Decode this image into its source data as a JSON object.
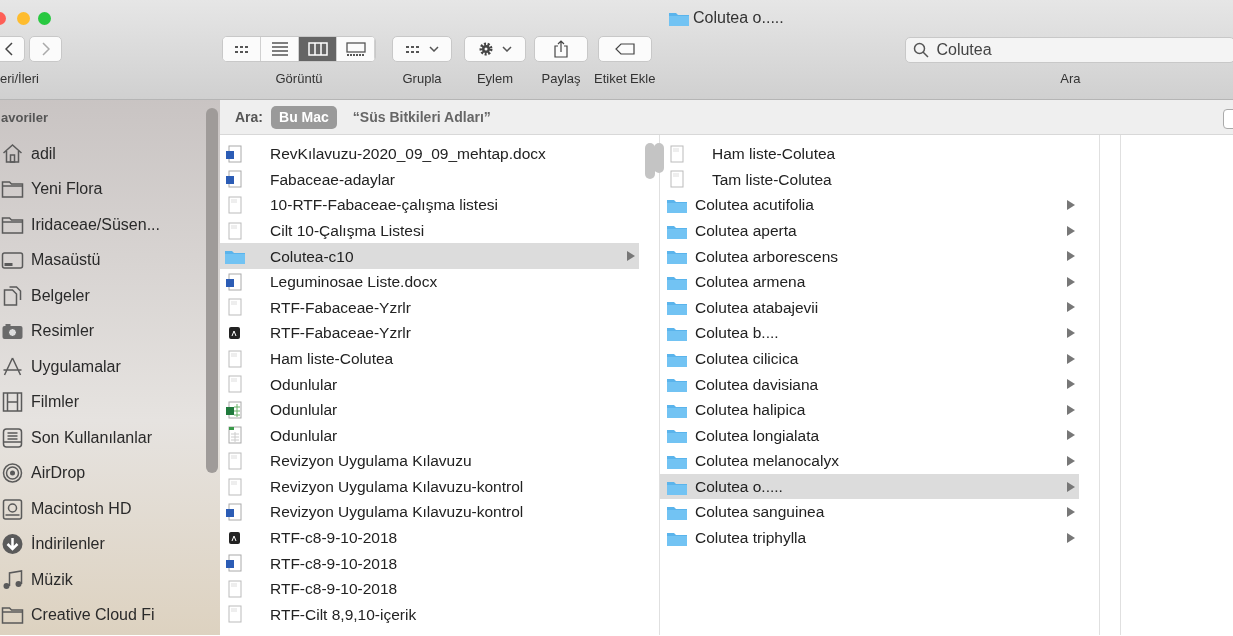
{
  "window": {
    "title": "Colutea o....."
  },
  "toolbar": {
    "nav_label": "eri/İleri",
    "view_modes": [
      {
        "kind": "icons",
        "selected": false
      },
      {
        "kind": "list",
        "selected": false
      },
      {
        "kind": "columns",
        "selected": true
      },
      {
        "kind": "gallery",
        "selected": false
      }
    ],
    "view_label": "Görüntü",
    "group_label": "Grupla",
    "action_label": "Eylem",
    "share_label": "Paylaş",
    "tag_label": "Etiket Ekle"
  },
  "search": {
    "value": "Colutea",
    "label": "Ara"
  },
  "scope_bar": {
    "label": "Ara:",
    "scopes": [
      {
        "label": "Bu Mac",
        "selected": true
      },
      {
        "label": "“Süs Bitkileri Adları”",
        "selected": false
      }
    ]
  },
  "sidebar": {
    "heading": "avoriler",
    "items": [
      {
        "kind": "home",
        "label": "adil"
      },
      {
        "kind": "folder",
        "label": "Yeni Flora"
      },
      {
        "kind": "folder",
        "label": "Iridaceae/Süsen..."
      },
      {
        "kind": "desktop",
        "label": "Masaüstü"
      },
      {
        "kind": "documents",
        "label": "Belgeler"
      },
      {
        "kind": "pictures",
        "label": "Resimler"
      },
      {
        "kind": "apps",
        "label": "Uygulamalar"
      },
      {
        "kind": "movies",
        "label": "Filmler"
      },
      {
        "kind": "recents",
        "label": "Son Kullanılanlar"
      },
      {
        "kind": "airdrop",
        "label": "AirDrop"
      },
      {
        "kind": "disk",
        "label": "Macintosh HD"
      },
      {
        "kind": "downloads",
        "label": "İndirilenler"
      },
      {
        "kind": "music",
        "label": "Müzik"
      },
      {
        "kind": "folder",
        "label": "Creative Cloud Fi"
      }
    ]
  },
  "columns": [
    {
      "rows": [
        {
          "kind": "word",
          "name": "RevKılavuzu-2020_09_09_mehtap.docx",
          "selected": false
        },
        {
          "kind": "word",
          "name": "Fabaceae-adaylar",
          "selected": false
        },
        {
          "kind": "doc",
          "name": "10-RTF-Fabaceae-çalışma listesi",
          "selected": false
        },
        {
          "kind": "doc",
          "name": "Cilt 10-Çalışma Listesi",
          "selected": false
        },
        {
          "kind": "folder",
          "name": "Colutea-c10",
          "selected": true
        },
        {
          "kind": "word",
          "name": "Leguminosae Liste.docx",
          "selected": false
        },
        {
          "kind": "doc",
          "name": "RTF-Fabaceae-Yzrlr",
          "selected": false
        },
        {
          "kind": "pdf",
          "name": "RTF-Fabaceae-Yzrlr",
          "selected": false
        },
        {
          "kind": "doc",
          "name": "Ham liste-Colutea",
          "selected": false
        },
        {
          "kind": "doc",
          "name": "Odunlular",
          "selected": false
        },
        {
          "kind": "excel",
          "name": "Odunlular",
          "selected": false
        },
        {
          "kind": "sheet",
          "name": "Odunlular",
          "selected": false
        },
        {
          "kind": "doc",
          "name": "Revizyon Uygulama Kılavuzu",
          "selected": false
        },
        {
          "kind": "doc",
          "name": "Revizyon Uygulama Kılavuzu-kontrol",
          "selected": false
        },
        {
          "kind": "word",
          "name": "Revizyon Uygulama Kılavuzu-kontrol",
          "selected": false
        },
        {
          "kind": "pdf",
          "name": "RTF-c8-9-10-2018",
          "selected": false
        },
        {
          "kind": "word",
          "name": "RTF-c8-9-10-2018",
          "selected": false
        },
        {
          "kind": "doc",
          "name": "RTF-c8-9-10-2018",
          "selected": false
        },
        {
          "kind": "doc",
          "name": "RTF-Cilt 8,9,10-içerik",
          "selected": false
        }
      ]
    },
    {
      "rows": [
        {
          "kind": "doc",
          "name": "Ham liste-Colutea",
          "selected": false
        },
        {
          "kind": "doc",
          "name": "Tam liste-Colutea",
          "selected": false
        },
        {
          "kind": "folder",
          "name": "Colutea acutifolia",
          "selected": false
        },
        {
          "kind": "folder",
          "name": "Colutea aperta",
          "selected": false
        },
        {
          "kind": "folder",
          "name": "Colutea arborescens",
          "selected": false
        },
        {
          "kind": "folder",
          "name": "Colutea armena",
          "selected": false
        },
        {
          "kind": "folder",
          "name": "Colutea atabajevii",
          "selected": false
        },
        {
          "kind": "folder",
          "name": "Colutea b....",
          "selected": false
        },
        {
          "kind": "folder",
          "name": "Colutea cilicica",
          "selected": false
        },
        {
          "kind": "folder",
          "name": "Colutea davisiana",
          "selected": false
        },
        {
          "kind": "folder",
          "name": "Colutea halipica",
          "selected": false
        },
        {
          "kind": "folder",
          "name": "Colutea longialata",
          "selected": false
        },
        {
          "kind": "folder",
          "name": "Colutea melanocalyx",
          "selected": false
        },
        {
          "kind": "folder",
          "name": "Colutea o.....",
          "selected": true
        },
        {
          "kind": "folder",
          "name": "Colutea sanguinea",
          "selected": false
        },
        {
          "kind": "folder",
          "name": "Colutea triphylla",
          "selected": false
        }
      ]
    }
  ]
}
